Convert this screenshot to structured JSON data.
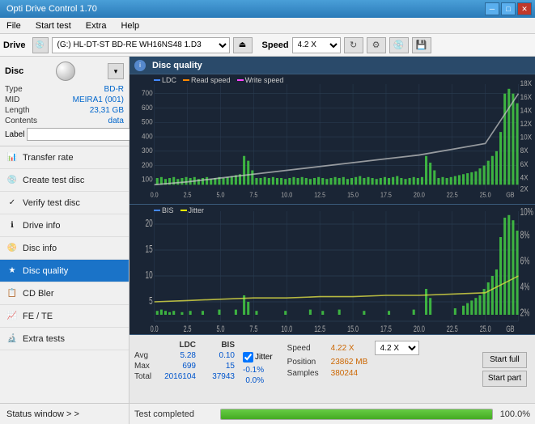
{
  "app": {
    "title": "Opti Drive Control 1.70",
    "window_controls": [
      "minimize",
      "maximize",
      "close"
    ]
  },
  "menu": {
    "items": [
      "File",
      "Start test",
      "Extra",
      "Help"
    ]
  },
  "drive_bar": {
    "label": "Drive",
    "drive_value": "(G:)  HL-DT-ST BD-RE  WH16NS48 1.D3",
    "speed_label": "Speed",
    "speed_value": "4.2 X"
  },
  "disc_section": {
    "disc_type_label": "Type",
    "disc_type_value": "BD-R",
    "mid_label": "MID",
    "mid_value": "MEIRA1 (001)",
    "length_label": "Length",
    "length_value": "23,31 GB",
    "contents_label": "Contents",
    "contents_value": "data",
    "label_label": "Label",
    "label_placeholder": ""
  },
  "nav_items": [
    {
      "id": "transfer-rate",
      "label": "Transfer rate",
      "icon": "📊"
    },
    {
      "id": "create-test-disc",
      "label": "Create test disc",
      "icon": "💿"
    },
    {
      "id": "verify-test-disc",
      "label": "Verify test disc",
      "icon": "✓"
    },
    {
      "id": "drive-info",
      "label": "Drive info",
      "icon": "ℹ"
    },
    {
      "id": "disc-info",
      "label": "Disc info",
      "icon": "📀"
    },
    {
      "id": "disc-quality",
      "label": "Disc quality",
      "icon": "★",
      "active": true
    },
    {
      "id": "cd-bler",
      "label": "CD Bler",
      "icon": "📋"
    },
    {
      "id": "fe-te",
      "label": "FE / TE",
      "icon": "📈"
    },
    {
      "id": "extra-tests",
      "label": "Extra tests",
      "icon": "🔬"
    }
  ],
  "status_window": {
    "label": "Status window > >"
  },
  "disc_quality": {
    "title": "Disc quality",
    "legend": {
      "ldc": "LDC",
      "read_speed": "Read speed",
      "write_speed": "Write speed",
      "bis": "BIS",
      "jitter": "Jitter"
    },
    "chart1": {
      "y_max": 700,
      "y_right_max": 18,
      "x_max": 25,
      "x_ticks": [
        "0.0",
        "2.5",
        "5.0",
        "7.5",
        "10.0",
        "12.5",
        "15.0",
        "17.5",
        "20.0",
        "22.5",
        "25.0"
      ],
      "y_ticks": [
        "100",
        "200",
        "300",
        "400",
        "500",
        "600",
        "700"
      ],
      "y_right_ticks": [
        "2X",
        "4X",
        "6X",
        "8X",
        "10X",
        "12X",
        "14X",
        "16X",
        "18X"
      ]
    },
    "chart2": {
      "y_max": 20,
      "y_right_max": 10,
      "x_max": 25,
      "x_ticks": [
        "0.0",
        "2.5",
        "5.0",
        "7.5",
        "10.0",
        "12.5",
        "15.0",
        "17.5",
        "20.0",
        "22.5",
        "25.0"
      ],
      "y_ticks": [
        "5",
        "10",
        "15",
        "20"
      ],
      "y_right_ticks": [
        "2%",
        "4%",
        "6%",
        "8%",
        "10%"
      ]
    }
  },
  "stats": {
    "headers": [
      "",
      "LDC",
      "BIS",
      "",
      "Jitter",
      "Speed",
      ""
    ],
    "avg_label": "Avg",
    "max_label": "Max",
    "total_label": "Total",
    "ldc_avg": "5.28",
    "ldc_max": "699",
    "ldc_total": "2016104",
    "bis_avg": "0.10",
    "bis_max": "15",
    "bis_total": "37943",
    "jitter_avg": "-0.1%",
    "jitter_max": "0.0%",
    "jitter_checked": true,
    "speed_label": "Speed",
    "speed_value": "4.22 X",
    "speed_select": "4.2 X",
    "position_label": "Position",
    "position_value": "23862 MB",
    "samples_label": "Samples",
    "samples_value": "380244",
    "start_full_label": "Start full",
    "start_part_label": "Start part"
  },
  "progress": {
    "status": "Test completed",
    "percentage": "100.0%",
    "fill_pct": 100
  }
}
